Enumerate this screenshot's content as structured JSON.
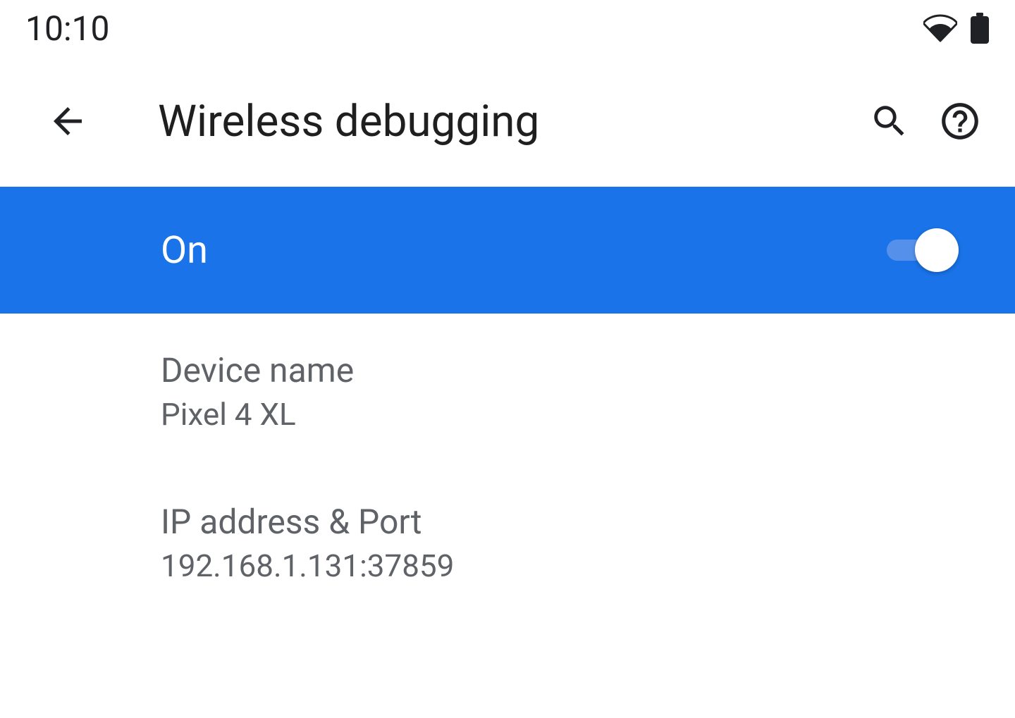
{
  "status_bar": {
    "time": "10:10"
  },
  "app_bar": {
    "title": "Wireless debugging"
  },
  "master_switch": {
    "label": "On",
    "state": "on"
  },
  "prefs": {
    "device_name": {
      "title": "Device name",
      "summary": "Pixel 4 XL"
    },
    "ip_port": {
      "title": "IP address & Port",
      "summary": "192.168.1.131:37859"
    }
  }
}
